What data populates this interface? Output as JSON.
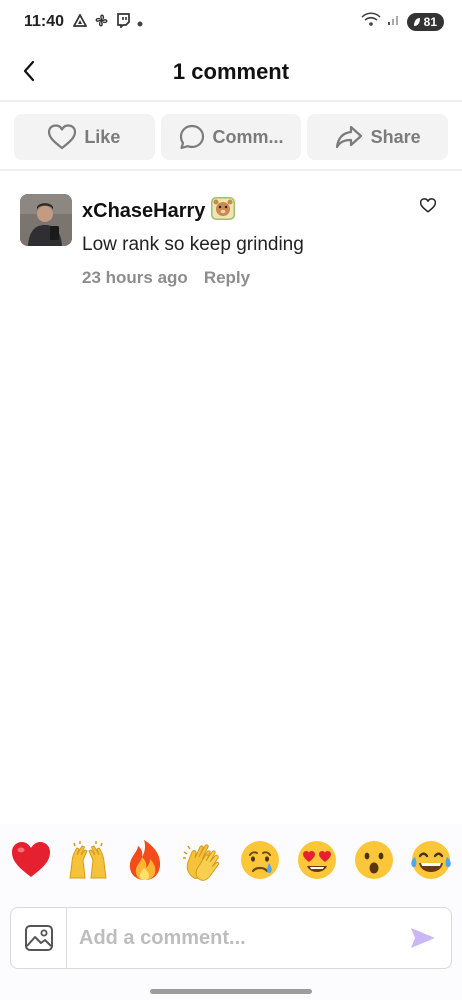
{
  "status_bar": {
    "time": "11:40",
    "battery": "81",
    "network": "6E"
  },
  "header": {
    "title": "1 comment"
  },
  "actions": [
    {
      "label": "Like",
      "icon": "heart-icon"
    },
    {
      "label": "Comm...",
      "icon": "comment-icon"
    },
    {
      "label": "Share",
      "icon": "share-icon"
    }
  ],
  "comment": {
    "username": "xChaseHarry",
    "text": "Low rank so keep grinding",
    "time": "23 hours ago",
    "reply_label": "Reply"
  },
  "reactions": [
    "❤️",
    "🙌",
    "🔥",
    "👏",
    "😢",
    "😍",
    "😮",
    "😂"
  ],
  "composer": {
    "placeholder": "Add a comment..."
  },
  "colors": {
    "accent_send": "#c9b8f5",
    "muted_text": "#8d8d8d",
    "button_bg": "#f3f3f3"
  }
}
